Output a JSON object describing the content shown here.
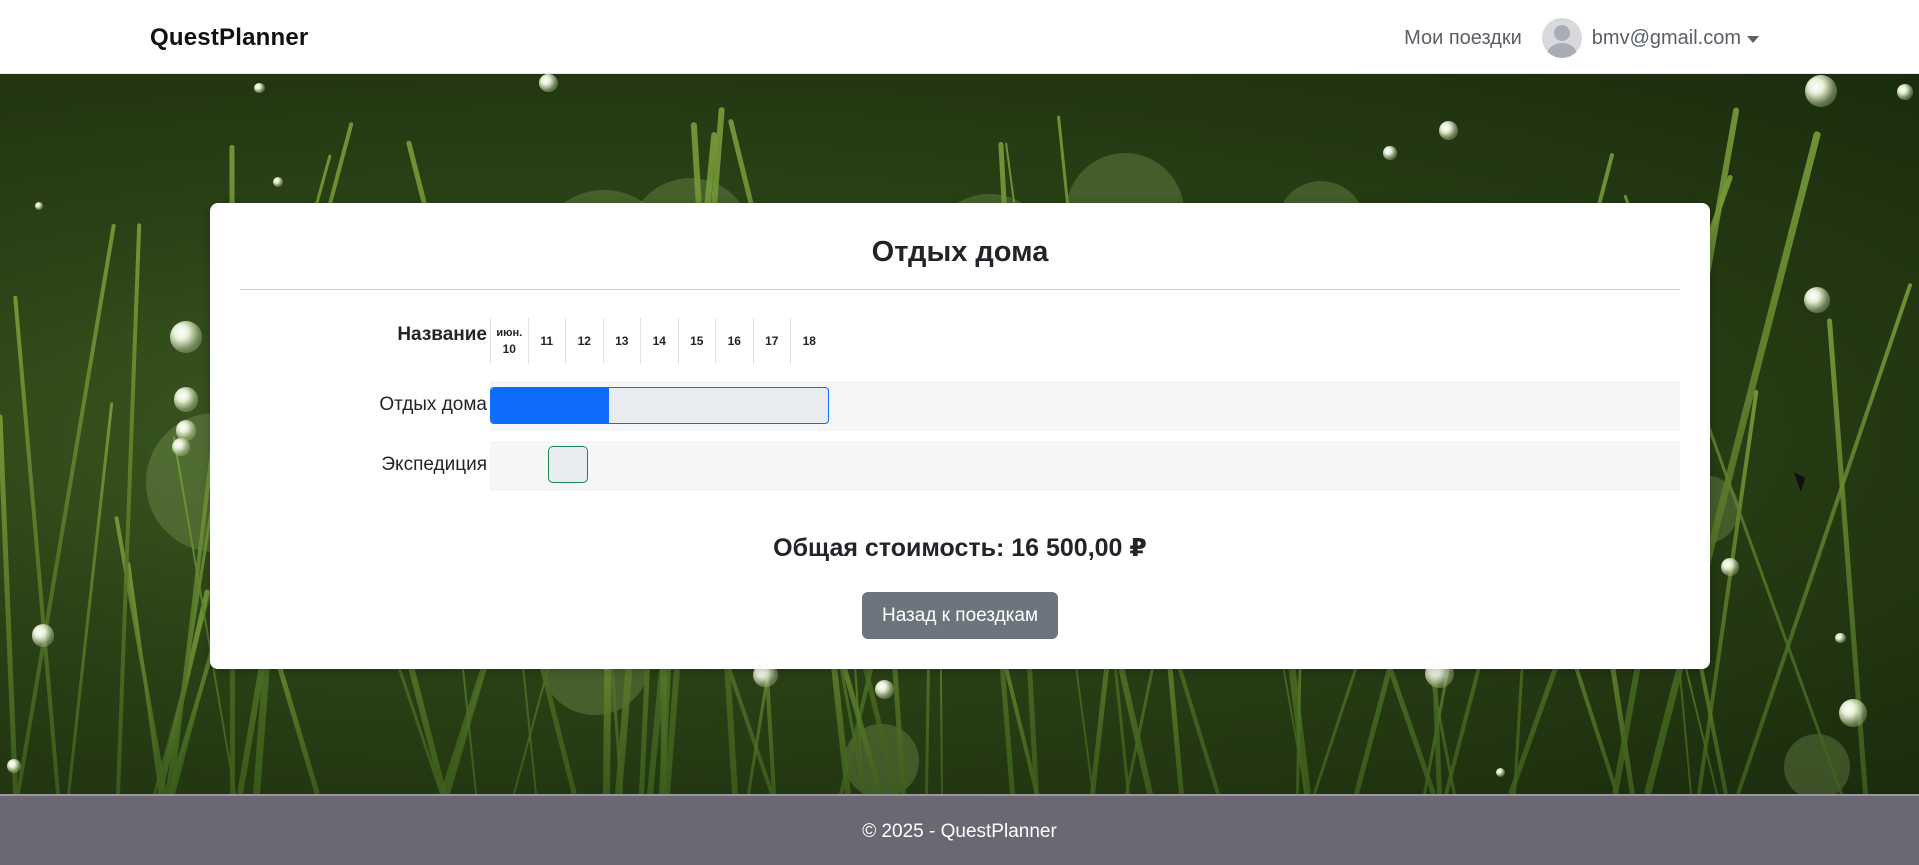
{
  "navbar": {
    "brand": "QuestPlanner",
    "my_trips": "Мои поездки",
    "user_email": "bmv@gmail.com"
  },
  "trip": {
    "title": "Отдых дома",
    "name_header": "Название",
    "month_label": "июн.",
    "days": [
      "10",
      "11",
      "12",
      "13",
      "14",
      "15",
      "16",
      "17",
      "18"
    ],
    "rows": [
      {
        "label": "Отдых дома",
        "progress_percent": 35
      },
      {
        "label": "Экспедиция"
      }
    ],
    "total_cost": "Общая стоимость: 16 500,00 ₽",
    "back_button": "Назад к поездкам"
  },
  "colors": {
    "primary": "#0d6efd",
    "success": "#198754",
    "secondary": "#6c757d",
    "footer": "#6b6874"
  },
  "footer": {
    "text": "© 2025 - QuestPlanner"
  }
}
